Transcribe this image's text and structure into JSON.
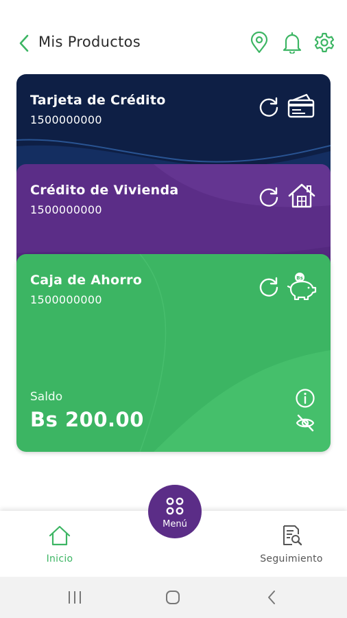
{
  "header": {
    "title": "Mis Productos",
    "icons": [
      "back-icon",
      "location-pin-icon",
      "bell-icon",
      "gear-icon"
    ]
  },
  "colors": {
    "brand_green": "#3cb563",
    "brand_purple": "#5b2d87",
    "credit_card_navy": "#0e1f45"
  },
  "cards": [
    {
      "name": "Tarjeta de Crédito",
      "number": "1500000000",
      "icon": "credit-card-icon"
    },
    {
      "name": "Crédito de Vivienda",
      "number": "1500000000",
      "icon": "house-icon"
    },
    {
      "name": "Caja de Ahorro",
      "number": "1500000000",
      "icon": "piggy-bank-icon",
      "balance_label": "Saldo",
      "balance_value": "Bs 200.00"
    }
  ],
  "bottom_nav": {
    "home_label": "Inicio",
    "menu_label": "Menú",
    "tracking_label": "Seguimiento"
  },
  "system_nav": [
    "recents-icon",
    "home-icon",
    "back-icon"
  ]
}
